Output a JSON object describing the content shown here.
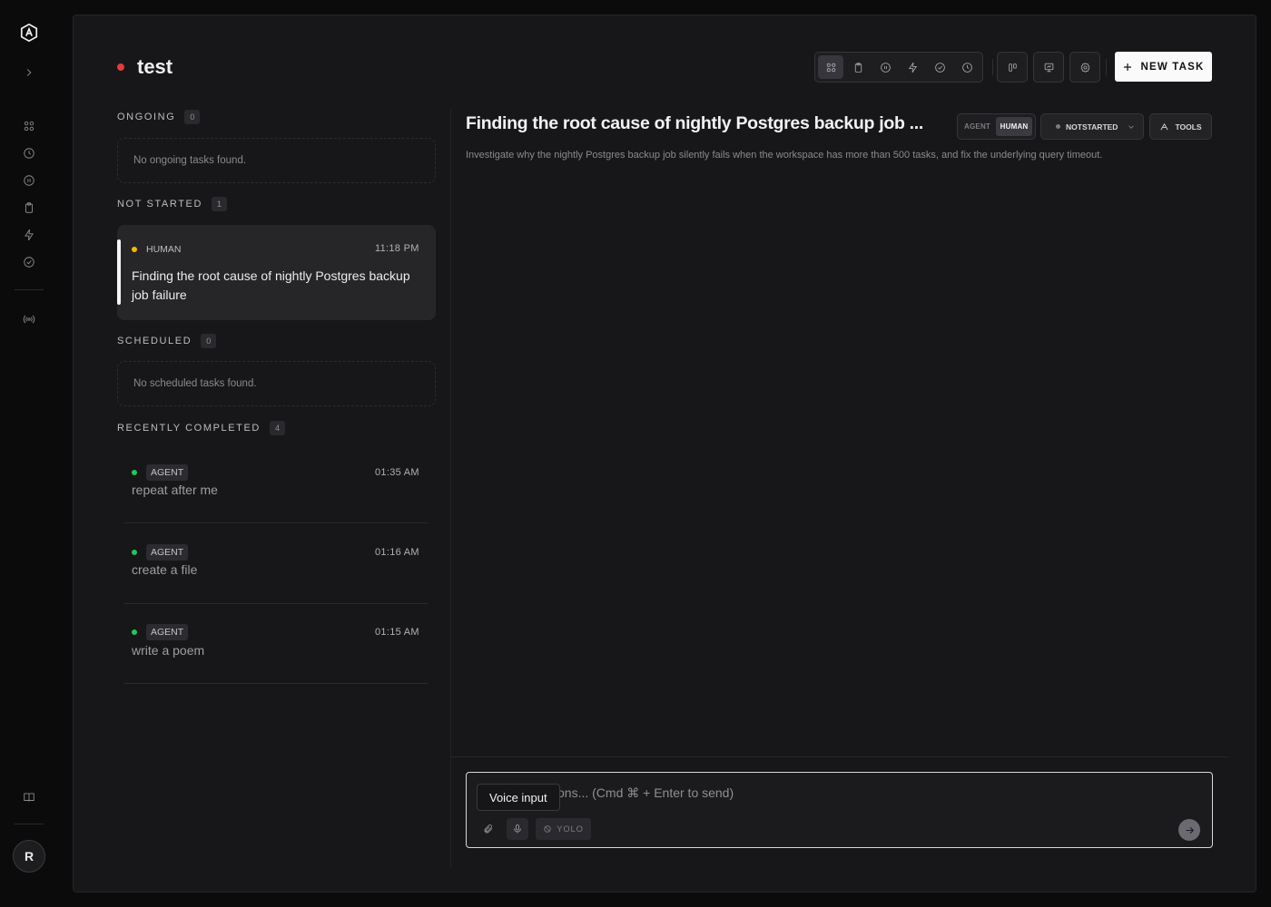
{
  "rail": {
    "icons": [
      "logo-icon",
      "chevron-right-icon",
      "grid-icon",
      "clock-icon",
      "pause-icon",
      "clipboard-icon",
      "bolt-icon",
      "check-circle-icon",
      "broadcast-icon",
      "book-icon"
    ],
    "avatar_initial": "R"
  },
  "header": {
    "project_title": "test",
    "status_color": "#e23b3b",
    "new_task_label": "NEW TASK"
  },
  "sections": {
    "ongoing": {
      "label": "ONGOING",
      "count": "0",
      "empty_text": "No ongoing tasks found."
    },
    "not_started": {
      "label": "NOT STARTED",
      "count": "1",
      "tasks": [
        {
          "owner": "HUMAN",
          "time": "11:18 PM",
          "title": "Finding the root cause of nightly Postgres backup job failure",
          "dot_color": "#f5b800"
        }
      ]
    },
    "scheduled": {
      "label": "SCHEDULED",
      "count": "0",
      "empty_text": "No scheduled tasks found."
    },
    "recently_completed": {
      "label": "RECENTLY COMPLETED",
      "count": "4",
      "tasks": [
        {
          "owner": "AGENT",
          "time": "01:35 AM",
          "title": "repeat after me",
          "dot_color": "#22c55e"
        },
        {
          "owner": "AGENT",
          "time": "01:16 AM",
          "title": "create a file",
          "dot_color": "#22c55e"
        },
        {
          "owner": "AGENT",
          "time": "01:15 AM",
          "title": "write a poem",
          "dot_color": "#22c55e"
        }
      ]
    }
  },
  "detail": {
    "title": "Finding the root cause of nightly Postgres backup job ...",
    "toggle": {
      "agent": "AGENT",
      "human": "HUMAN",
      "selected": "HUMAN"
    },
    "status": "NOTSTARTED",
    "tools_label": "TOOLS",
    "description": "Investigate why the nightly Postgres backup job silently fails when the workspace has more than 500 tasks, and fix the underlying query timeout."
  },
  "composer": {
    "placeholder_visible": "ons... (Cmd ⌘ + Enter to send)",
    "tooltip": "Voice input",
    "yolo_label": "YOLO"
  }
}
